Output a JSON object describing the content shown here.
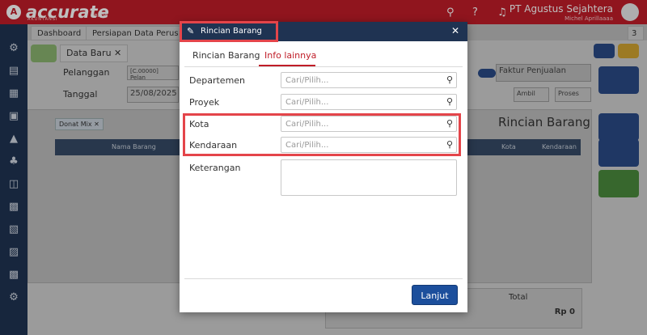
{
  "app": {
    "logo_text": "accurate",
    "logo_sub": "AKUNTANSI",
    "logo_online": "online",
    "company": "PT Agustus Sejahtera",
    "user": "Michel Aprillaaaa"
  },
  "tabs": {
    "dashboard": "Dashboard",
    "persiapan": "Persiapan Data Perus",
    "count": "3"
  },
  "form": {
    "doc_tab": "Data Baru",
    "pelanggan_label": "Pelanggan",
    "pelanggan_value": "[C.00000] Pelan",
    "tanggal_label": "Tanggal",
    "tanggal_value": "25/08/2025",
    "faktur_label": "Faktur Penjualan",
    "ambil_label": "Ambil",
    "proses_label": "Proses",
    "chip_label": "Donat Mix",
    "grid_nama": "Nama Barang",
    "grid_kota": "Kota",
    "grid_kendaraan": "Kendaraan",
    "rincian_title": "Rincian Barang",
    "total_label": "Total",
    "total_value": "Rp 0",
    "rp_left": "Rp 0"
  },
  "modal": {
    "title": "Rincian Barang",
    "tabs": [
      "Rincian Barang",
      "Info lainnya"
    ],
    "fields": [
      {
        "label": "Departemen",
        "placeholder": "Cari/Pilih..."
      },
      {
        "label": "Proyek",
        "placeholder": "Cari/Pilih..."
      },
      {
        "label": "Kota",
        "placeholder": "Cari/Pilih..."
      },
      {
        "label": "Kendaraan",
        "placeholder": "Cari/Pilih..."
      }
    ],
    "keterangan_label": "Keterangan",
    "button_next": "Lanjut"
  },
  "colors": {
    "brand_red": "#c01d28",
    "navy": "#1f3352",
    "button_blue": "#1c4f9c",
    "highlight": "#e4454a"
  }
}
